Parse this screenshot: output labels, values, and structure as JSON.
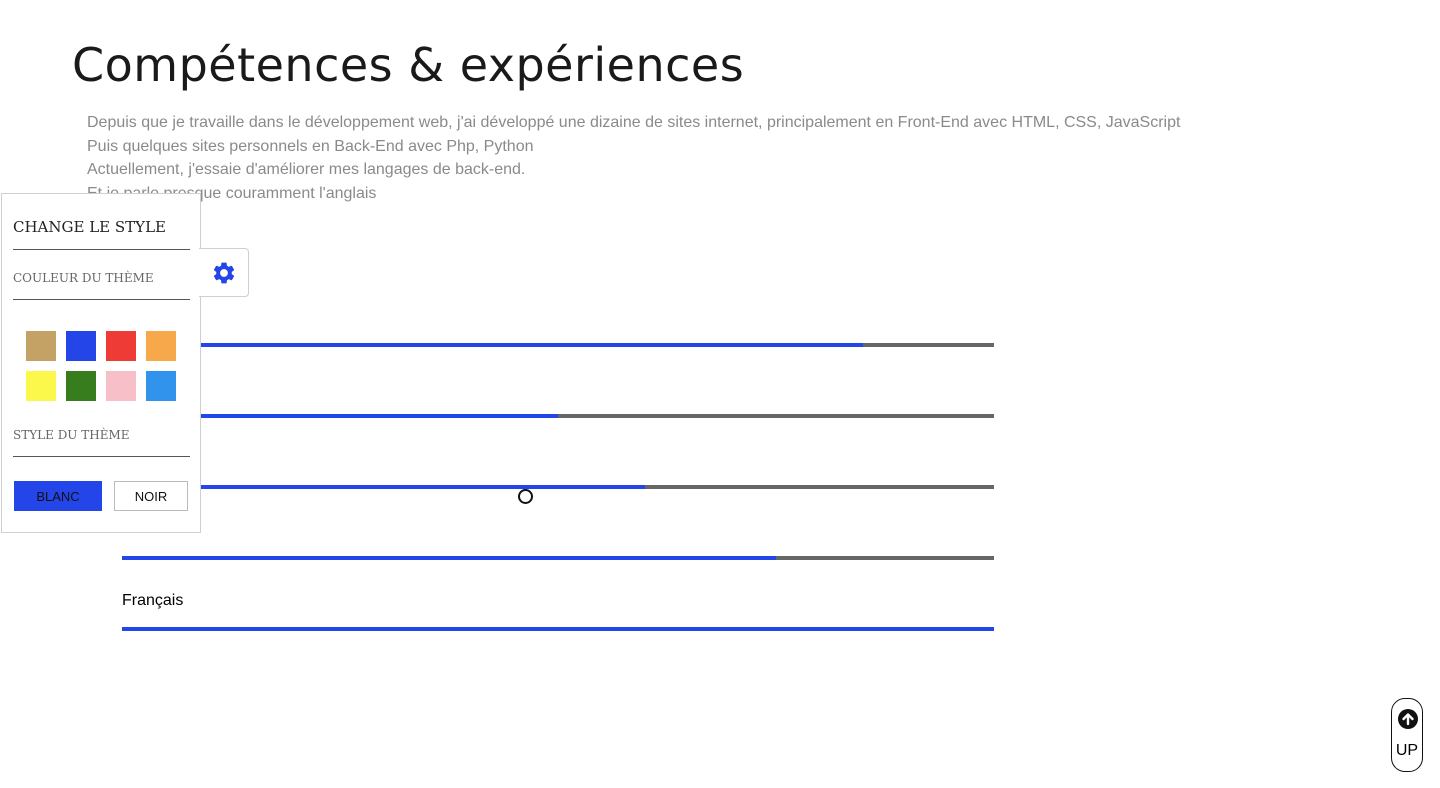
{
  "page": {
    "title": "Compétences & expériences",
    "intro": [
      "Depuis que je travaille dans le développement web, j'ai développé une dizaine de sites internet, principalement en Front-End avec HTML, CSS, JavaScript",
      "Puis quelques sites personnels en Back-End avec Php, Python",
      "Actuellement, j'essaie d'améliorer mes langages de back-end.",
      "Et je parle presque couramment l'anglais"
    ]
  },
  "skills": [
    {
      "label": "",
      "level_percent": 85
    },
    {
      "label": "",
      "level_percent": 50
    },
    {
      "label": "",
      "level_percent": 60
    },
    {
      "label": "",
      "level_percent": 75
    },
    {
      "label": "Français",
      "level_percent": 100
    }
  ],
  "style_panel": {
    "title": "CHANGE LE STYLE",
    "color_section": "COULEUR DU THÈME",
    "style_section": "STYLE DU THÈME",
    "swatches": [
      "#c4a265",
      "#2446e8",
      "#ee3b36",
      "#f7a84a",
      "#fcf74b",
      "#377c1d",
      "#f7c0c9",
      "#3293ec"
    ],
    "buttons": {
      "white": "BLANC",
      "black": "NOIR"
    },
    "accent_color": "#2446e8"
  },
  "icons": {
    "settings": "gear-icon",
    "up": "arrow-up-circle-icon"
  },
  "up_button": {
    "label": "UP"
  }
}
